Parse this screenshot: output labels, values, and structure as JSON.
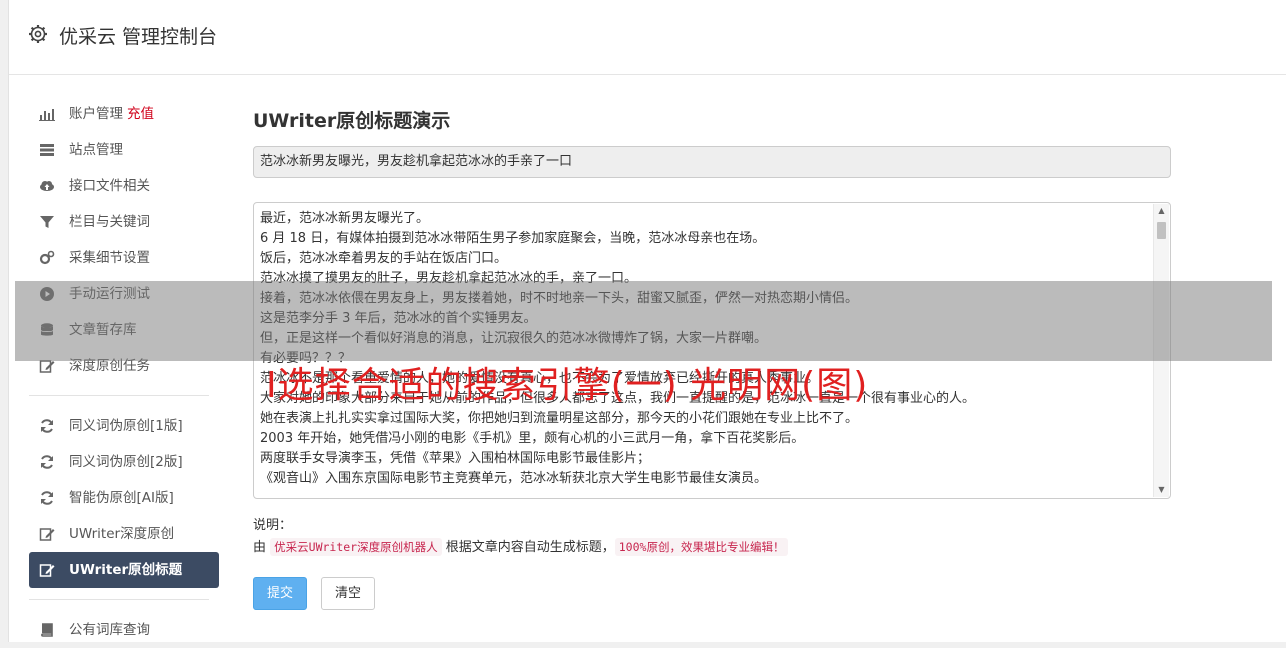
{
  "header": {
    "title": "优采云 管理控制台",
    "icon": "gear-icon"
  },
  "sidebar": {
    "group1": [
      {
        "label": "账户管理",
        "badge": "充值",
        "icon": "bar-chart-icon"
      },
      {
        "label": "站点管理",
        "icon": "server-icon"
      },
      {
        "label": "接口文件相关",
        "icon": "cloud-upload-icon"
      },
      {
        "label": "栏目与关键词",
        "icon": "filter-icon"
      },
      {
        "label": "采集细节设置",
        "icon": "gears-icon"
      },
      {
        "label": "手动运行测试",
        "icon": "play-circle-icon"
      },
      {
        "label": "文章暂存库",
        "icon": "database-icon"
      },
      {
        "label": "深度原创任务",
        "icon": "edit-icon"
      }
    ],
    "group2": [
      {
        "label": "同义词伪原创[1版]",
        "icon": "refresh-icon"
      },
      {
        "label": "同义词伪原创[2版]",
        "icon": "refresh-icon"
      },
      {
        "label": "智能伪原创[AI版]",
        "icon": "refresh-icon"
      },
      {
        "label": "UWriter深度原创",
        "icon": "edit-icon"
      },
      {
        "label": "UWriter原创标题",
        "icon": "edit-icon",
        "active": true
      }
    ],
    "group3": [
      {
        "label": "公有词库查询",
        "icon": "book-icon"
      }
    ]
  },
  "main": {
    "heading": "UWriter原创标题演示",
    "title_value": "范冰冰新男友曝光，男友趁机拿起范冰冰的手亲了一口",
    "content_lines": [
      "最近，范冰冰新男友曝光了。",
      "6 月 18 日，有媒体拍摄到范冰冰带陌生男子参加家庭聚会，当晚，范冰冰母亲也在场。",
      "饭后，范冰冰牵着男友的手站在饭店门口。",
      "范冰冰摸了摸男友的肚子，男友趁机拿起范冰冰的手，亲了一口。",
      "接着，范冰冰依偎在男友身上，男友搂着她，时不时地亲一下头，甜蜜又腻歪，俨然一对热恋期小情侣。",
      "这是范李分手 3 年后，范冰冰的首个实锤男友。",
      "但，正是这样一个看似好消息的消息，让沉寂很久的范冰冰微博炸了锅，大家一片群嘲。",
      "有必要吗？？？",
      "范冰冰不是那个看重爱情的人，她的爱情没有真心，也不会为了爱情放弃已经撕开的真人秀事业。",
      "大家对她的印象大部分来自于她从前的作品，但很多人都忘了这点，我们一直提醒的是，范冰冰一直是一个很有事业心的人。",
      "她在表演上扎扎实实拿过国际大奖，你把她归到流量明星这部分，那今天的小花们跟她在专业上比不了。",
      "2003 年开始，她凭借冯小刚的电影《手机》里，颇有心机的小三武月一角，拿下百花奖影后。",
      "两度联手女导演李玉，凭借《苹果》入围柏林国际电影节最佳影片；",
      "《观音山》入围东京国际电影节主竞赛单元，范冰冰斩获北京大学生电影节最佳女演员。"
    ],
    "note_label": "说明：",
    "note_prefix": "由 ",
    "note_link": "优采云UWriter深度原创机器人",
    "note_middle": " 根据文章内容自动生成标题，",
    "note_code": "100%原创，效果堪比专业编辑！",
    "submit_label": "提交",
    "clear_label": "清空"
  },
  "overlay": {
    "text": "I选择合适的搜索引擎(一) 光明网(图)"
  },
  "colors": {
    "active_bg": "#3c4b63",
    "primary_button": "#5fb0f0",
    "badge": "#d0021b",
    "overlay_text": "#e02020"
  }
}
